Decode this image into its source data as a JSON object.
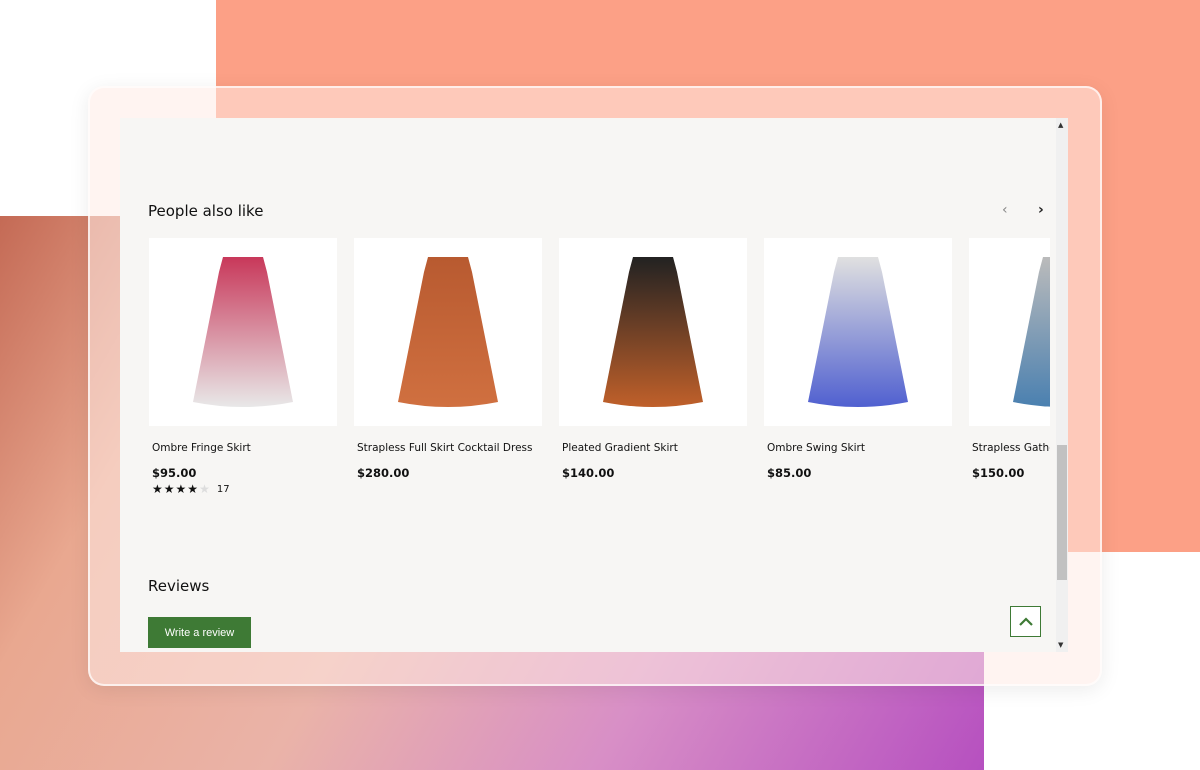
{
  "section_title": "People also like",
  "nav": {
    "prev_icon": "‹",
    "next_icon": "›"
  },
  "products": [
    {
      "name": "Ombre Fringe Skirt",
      "price": "$95.00",
      "rating": 4,
      "rating_count": "17",
      "colors": [
        "#c8385a",
        "#e8e8e8"
      ]
    },
    {
      "name": "Strapless Full Skirt Cocktail Dress",
      "price": "$280.00",
      "colors": [
        "#b85a30",
        "#d07040"
      ]
    },
    {
      "name": "Pleated Gradient Skirt",
      "price": "$140.00",
      "colors": [
        "#222222",
        "#c0602a"
      ]
    },
    {
      "name": "Ombre Swing Skirt",
      "price": "$85.00",
      "colors": [
        "#e0e0e0",
        "#5060d0"
      ]
    },
    {
      "name": "Strapless Gathered Dress",
      "price": "$150.00",
      "colors": [
        "#bbbbbb",
        "#4a80b0"
      ]
    }
  ],
  "reviews": {
    "title": "Reviews",
    "write_label": "Write a review"
  },
  "accent": "#3e7a35"
}
